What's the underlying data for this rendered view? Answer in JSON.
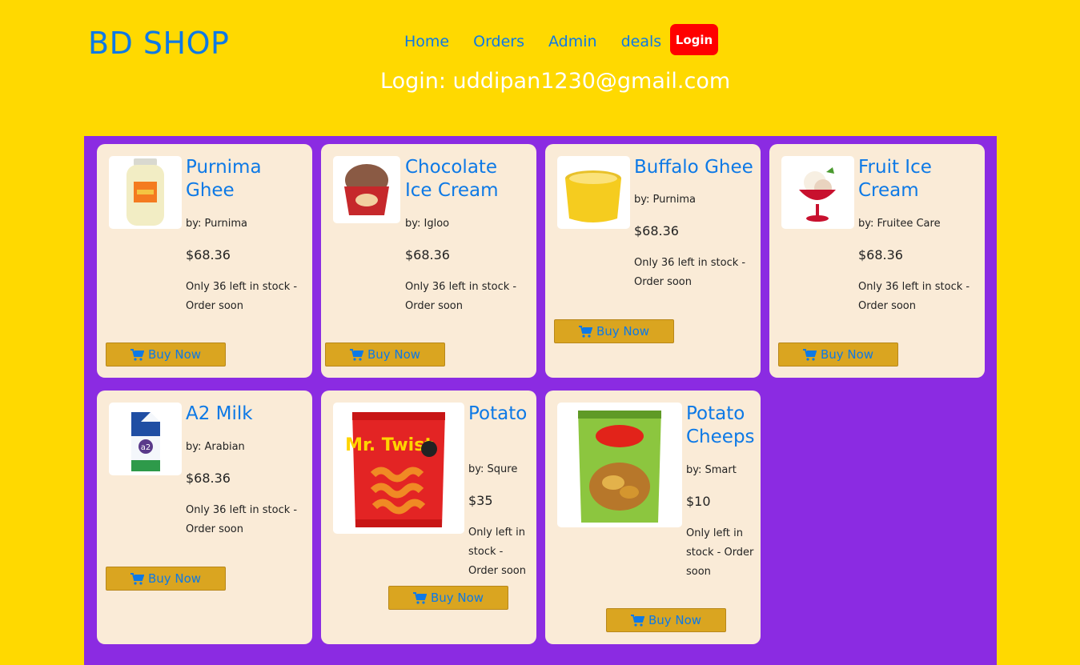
{
  "header": {
    "brand": "BD SHOP",
    "nav": [
      "Home",
      "Orders",
      "Admin",
      "deals"
    ],
    "login_label": "Login",
    "login_info": "Login: uddipan1230@gmail.com"
  },
  "buy_label": "Buy Now",
  "products": [
    {
      "name": "Purnima Ghee",
      "by": "by: Purnima",
      "price": "$68.36",
      "stock": "Only 36 left in stock - Order soon"
    },
    {
      "name": "Chocolate Ice Cream",
      "by": "by: Igloo",
      "price": "$68.36",
      "stock": "Only 36 left in stock - Order soon"
    },
    {
      "name": "Buffalo Ghee",
      "by": "by: Purnima",
      "price": "$68.36",
      "stock": "Only 36 left in stock - Order soon"
    },
    {
      "name": "Fruit Ice Cream",
      "by": "by: Fruitee Care",
      "price": "$68.36",
      "stock": "Only 36 left in stock - Order soon"
    },
    {
      "name": "A2 Milk",
      "by": "by: Arabian",
      "price": "$68.36",
      "stock": "Only 36 left in stock - Order soon"
    },
    {
      "name": "Potato",
      "by": "by: Squre",
      "price": "$35",
      "stock": "Only left in stock - Order soon"
    },
    {
      "name": "Potato Cheeps",
      "by": "by: Smart",
      "price": "$10",
      "stock": "Only left in stock - Order soon"
    }
  ],
  "image_labels": {
    "mr_twist": "Mr. Twist",
    "a2": "a2"
  }
}
